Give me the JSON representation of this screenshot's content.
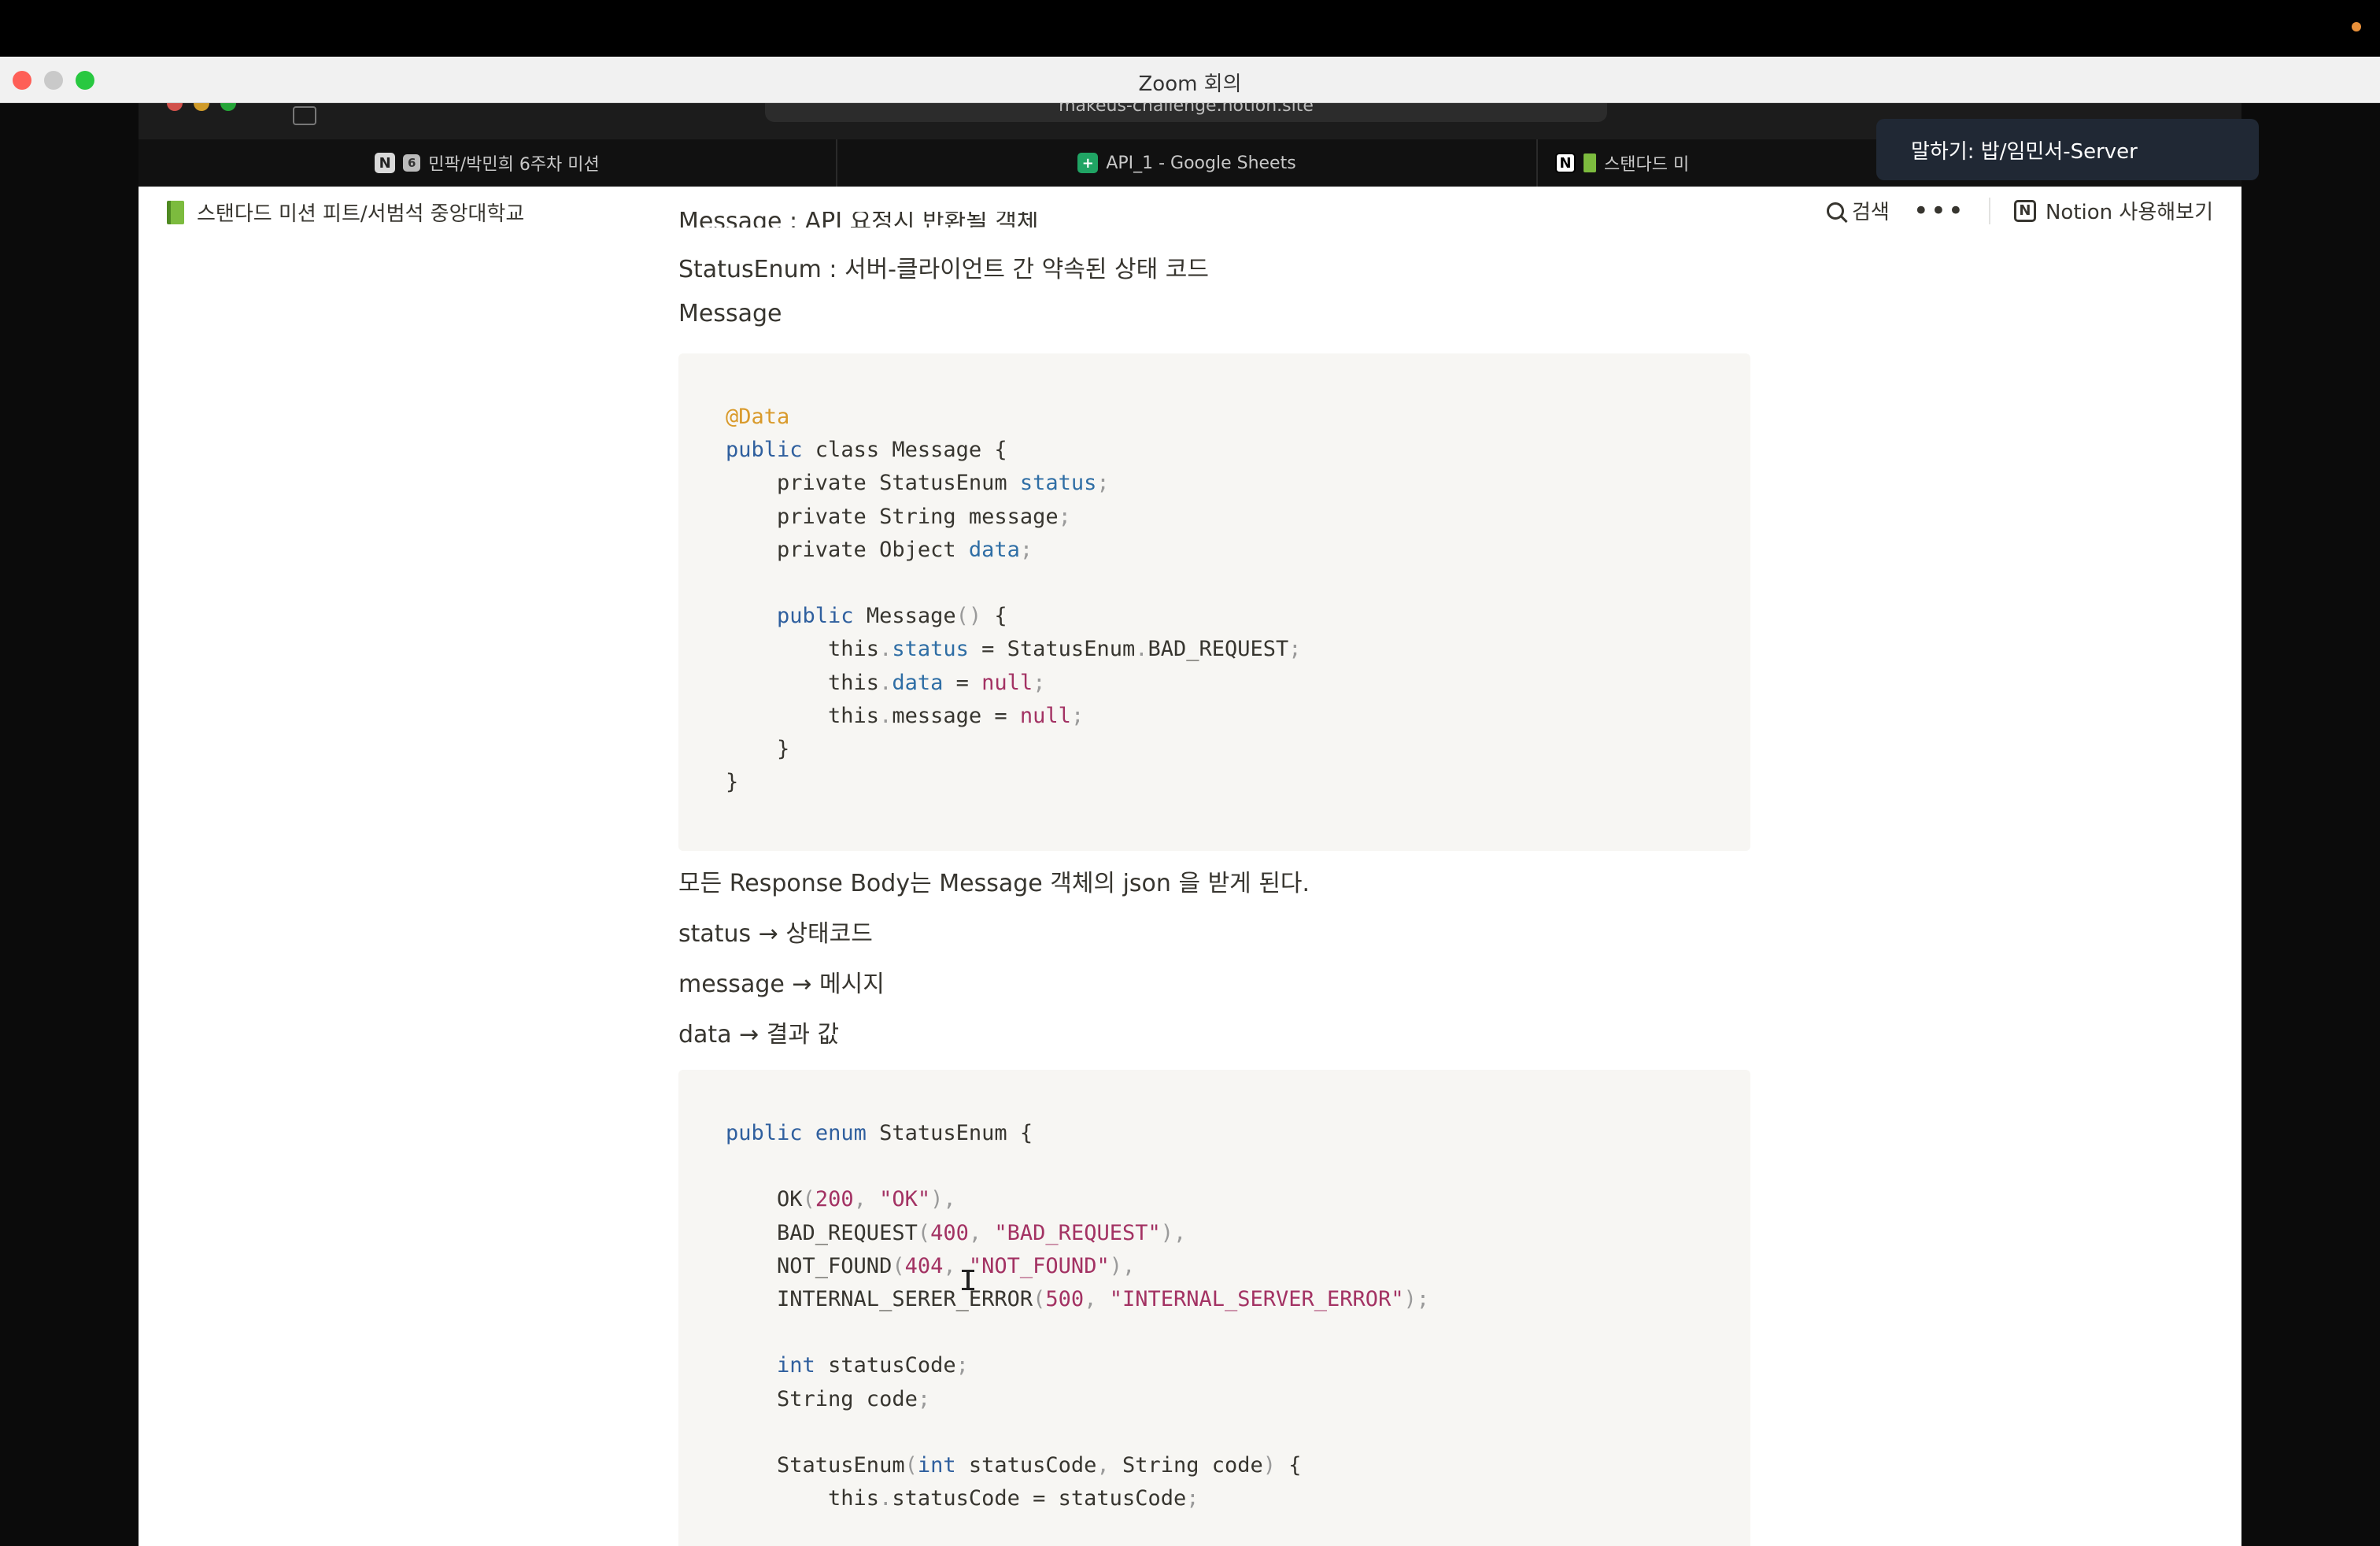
{
  "zoom": {
    "window_title": "Zoom 회의"
  },
  "browser": {
    "url": "makeus-challenge.notion.site",
    "tabs": [
      {
        "label": "민팍/박민희 6주차 미션",
        "icon": "notion-icon",
        "badge": "6"
      },
      {
        "label": "API_1 - Google Sheets",
        "icon": "google-sheets-icon"
      },
      {
        "label": "스탠다드 미",
        "icon": "notion-icon"
      }
    ]
  },
  "speaker_popup": {
    "text": "말하기: 밥/임민서-Server"
  },
  "notion": {
    "breadcrumb": "스탠다드 미션 피트/서범석 중앙대학교",
    "search_label": "검색",
    "more_label": "•••",
    "try_notion_label": "Notion 사용해보기",
    "paragraphs": {
      "cut_off": "Message : API 요청시 반환될 객체",
      "status_enum_desc": "StatusEnum : 서버-클라이언트 간 약속된 상태 코드",
      "message_heading": "Message",
      "response_body": "모든 Response Body는 Message 객체의 json 을 받게 된다.",
      "status_line": "status → 상태코드",
      "message_line": "message → 메시지",
      "data_line": "data → 결과 값"
    },
    "code_block_1_lines": [
      [
        [
          "ann",
          "@Data"
        ]
      ],
      [
        [
          "kw",
          "public"
        ],
        [
          "txt",
          " class Message {"
        ]
      ],
      [
        [
          "txt",
          "    private StatusEnum "
        ],
        [
          "field",
          "status"
        ],
        [
          "pun",
          ";"
        ]
      ],
      [
        [
          "txt",
          "    private String message"
        ],
        [
          "pun",
          ";"
        ]
      ],
      [
        [
          "txt",
          "    private Object "
        ],
        [
          "field",
          "data"
        ],
        [
          "pun",
          ";"
        ]
      ],
      [],
      [
        [
          "txt",
          "    "
        ],
        [
          "kw",
          "public"
        ],
        [
          "txt",
          " Message"
        ],
        [
          "pun",
          "()"
        ],
        [
          "txt",
          " {"
        ]
      ],
      [
        [
          "txt",
          "        this"
        ],
        [
          "pun",
          "."
        ],
        [
          "field",
          "status"
        ],
        [
          "txt",
          " = StatusEnum"
        ],
        [
          "pun",
          "."
        ],
        [
          "txt",
          "BAD_REQUEST"
        ],
        [
          "pun",
          ";"
        ]
      ],
      [
        [
          "txt",
          "        this"
        ],
        [
          "pun",
          "."
        ],
        [
          "field",
          "data"
        ],
        [
          "txt",
          " = "
        ],
        [
          "nul",
          "null"
        ],
        [
          "pun",
          ";"
        ]
      ],
      [
        [
          "txt",
          "        this"
        ],
        [
          "pun",
          "."
        ],
        [
          "txt",
          "message = "
        ],
        [
          "nul",
          "null"
        ],
        [
          "pun",
          ";"
        ]
      ],
      [
        [
          "txt",
          "    }"
        ]
      ],
      [
        [
          "txt",
          "}"
        ]
      ]
    ],
    "code_block_2_lines": [
      [
        [
          "kw",
          "public"
        ],
        [
          "txt",
          " "
        ],
        [
          "kw",
          "enum"
        ],
        [
          "txt",
          " StatusEnum {"
        ]
      ],
      [],
      [
        [
          "txt",
          "    OK"
        ],
        [
          "pun",
          "("
        ],
        [
          "num",
          "200"
        ],
        [
          "pun",
          ", "
        ],
        [
          "str",
          "\"OK\""
        ],
        [
          "pun",
          "),"
        ]
      ],
      [
        [
          "txt",
          "    BAD_REQUEST"
        ],
        [
          "pun",
          "("
        ],
        [
          "num",
          "400"
        ],
        [
          "pun",
          ", "
        ],
        [
          "str",
          "\"BAD_REQUEST\""
        ],
        [
          "pun",
          "),"
        ]
      ],
      [
        [
          "txt",
          "    NOT_FOUND"
        ],
        [
          "pun",
          "("
        ],
        [
          "num",
          "404"
        ],
        [
          "pun",
          ", "
        ],
        [
          "str",
          "\"NOT_FOUND\""
        ],
        [
          "pun",
          "),"
        ]
      ],
      [
        [
          "txt",
          "    INTERNAL_SERER_ERROR"
        ],
        [
          "pun",
          "("
        ],
        [
          "num",
          "500"
        ],
        [
          "pun",
          ", "
        ],
        [
          "str",
          "\"INTERNAL_SERVER_ERROR\""
        ],
        [
          "pun",
          ");"
        ]
      ],
      [],
      [
        [
          "txt",
          "    "
        ],
        [
          "kw",
          "int"
        ],
        [
          "txt",
          " statusCode"
        ],
        [
          "pun",
          ";"
        ]
      ],
      [
        [
          "txt",
          "    String code"
        ],
        [
          "pun",
          ";"
        ]
      ],
      [],
      [
        [
          "txt",
          "    StatusEnum"
        ],
        [
          "pun",
          "("
        ],
        [
          "kw",
          "int"
        ],
        [
          "txt",
          " statusCode"
        ],
        [
          "pun",
          ","
        ],
        [
          "txt",
          " String code"
        ],
        [
          "pun",
          ")"
        ],
        [
          "txt",
          " {"
        ]
      ],
      [
        [
          "txt",
          "        this"
        ],
        [
          "pun",
          "."
        ],
        [
          "txt",
          "statusCode = statusCode"
        ],
        [
          "pun",
          ";"
        ]
      ]
    ]
  },
  "colors": {
    "code_keyword": "#2f5f9e",
    "code_annotation": "#d99a2b",
    "code_string": "#a33263",
    "code_bg": "#f7f6f3",
    "notion_text": "#37352f",
    "popup_bg": "#202834"
  }
}
